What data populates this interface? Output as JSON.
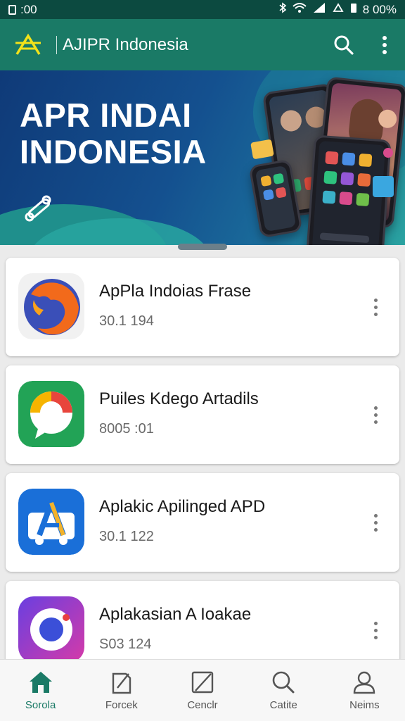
{
  "status_bar": {
    "time": ":00",
    "battery": "8 00%"
  },
  "app_bar": {
    "title": "AJIPR Indonesia"
  },
  "banner": {
    "line1": "APR INDAI",
    "line2": "INDONESIA"
  },
  "apps": [
    {
      "name": "ApPla Indoias Frase",
      "meta": "30.1 194"
    },
    {
      "name": "Puiles Kdego Artadils",
      "meta": "8005 :01"
    },
    {
      "name": "Aplakic Apilinged APD",
      "meta": "30.1 122"
    },
    {
      "name": "Aplakasian A Ioakae",
      "meta": "S03 124"
    }
  ],
  "nav": [
    {
      "label": "Sorola",
      "icon": "home-icon",
      "active": true
    },
    {
      "label": "Forcek",
      "icon": "edit-icon"
    },
    {
      "label": "Cenclr",
      "icon": "note-icon"
    },
    {
      "label": "Catite",
      "icon": "search-icon"
    },
    {
      "label": "Neims",
      "icon": "profile-icon"
    }
  ],
  "colors": {
    "accent": "#1a7a66",
    "banner": "#14508f"
  }
}
